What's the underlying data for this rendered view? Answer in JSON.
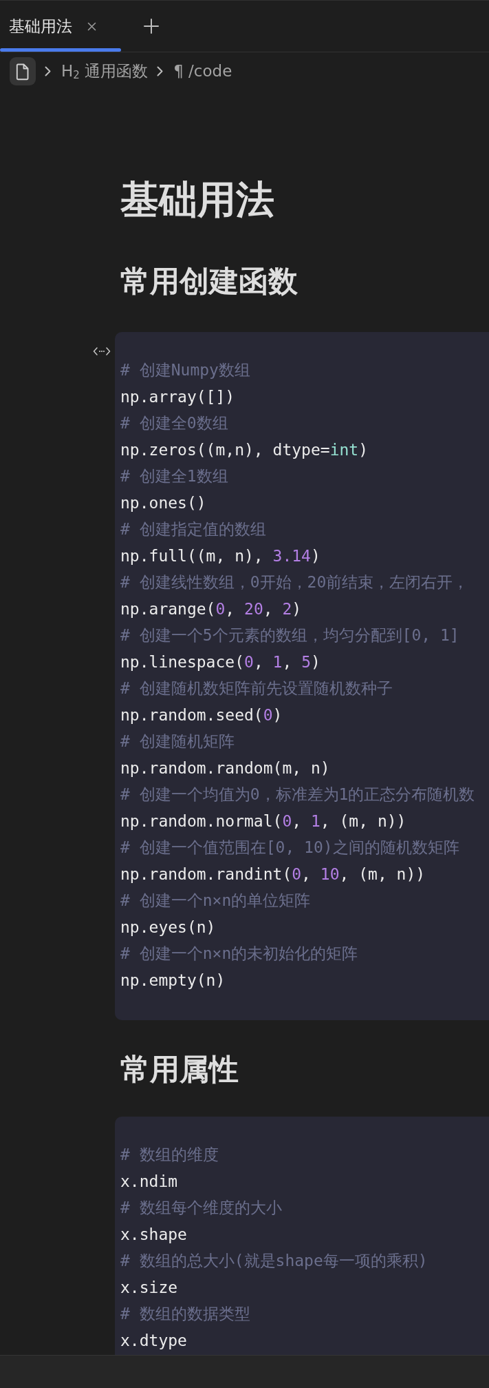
{
  "tabs": [
    {
      "label": "基础用法",
      "selected": true
    }
  ],
  "breadcrumb": [
    {
      "kind": "file"
    },
    {
      "kind": "heading",
      "marker": "H$_{2}$",
      "label": "通用函数"
    },
    {
      "kind": "paragraph",
      "marker": "¶",
      "label": "/code"
    }
  ],
  "title": "基础用法",
  "sections": [
    {
      "heading": "常用创建函数",
      "code_block": {
        "hovered": true,
        "lines": [
          [
            {
              "kind": "comment",
              "text": "# 创建Numpy数组"
            }
          ],
          [
            {
              "kind": "plain",
              "text": "np.array([])"
            }
          ],
          [
            {
              "kind": "comment",
              "text": "# 创建全0数组"
            }
          ],
          [
            {
              "kind": "plain",
              "text": "np.zeros((m,n), dtype="
            },
            {
              "kind": "builtin",
              "text": "int"
            },
            {
              "kind": "plain",
              "text": ")"
            }
          ],
          [
            {
              "kind": "comment",
              "text": "# 创建全1数组"
            }
          ],
          [
            {
              "kind": "plain",
              "text": "np.ones()"
            }
          ],
          [
            {
              "kind": "comment",
              "text": "# 创建指定值的数组"
            }
          ],
          [
            {
              "kind": "plain",
              "text": "np.full((m, n), "
            },
            {
              "kind": "number",
              "text": "3.14"
            },
            {
              "kind": "plain",
              "text": ")"
            }
          ],
          [
            {
              "kind": "comment",
              "text": "# 创建线性数组，0开始，20前结束，左闭右开，"
            }
          ],
          [
            {
              "kind": "plain",
              "text": "np.arange("
            },
            {
              "kind": "number",
              "text": "0"
            },
            {
              "kind": "plain",
              "text": ", "
            },
            {
              "kind": "number",
              "text": "20"
            },
            {
              "kind": "plain",
              "text": ", "
            },
            {
              "kind": "number",
              "text": "2"
            },
            {
              "kind": "plain",
              "text": ")"
            }
          ],
          [
            {
              "kind": "comment",
              "text": "# 创建一个5个元素的数组，均匀分配到[0, 1]"
            }
          ],
          [
            {
              "kind": "plain",
              "text": "np.linespace("
            },
            {
              "kind": "number",
              "text": "0"
            },
            {
              "kind": "plain",
              "text": ", "
            },
            {
              "kind": "number",
              "text": "1"
            },
            {
              "kind": "plain",
              "text": ", "
            },
            {
              "kind": "number",
              "text": "5"
            },
            {
              "kind": "plain",
              "text": ")"
            }
          ],
          [
            {
              "kind": "comment",
              "text": "# 创建随机数矩阵前先设置随机数种子"
            }
          ],
          [
            {
              "kind": "plain",
              "text": "np.random.seed("
            },
            {
              "kind": "number",
              "text": "0"
            },
            {
              "kind": "plain",
              "text": ")"
            }
          ],
          [
            {
              "kind": "comment",
              "text": "# 创建随机矩阵"
            }
          ],
          [
            {
              "kind": "plain",
              "text": "np.random.random(m, n)"
            }
          ],
          [
            {
              "kind": "comment",
              "text": "# 创建一个均值为0，标准差为1的正态分布随机数"
            }
          ],
          [
            {
              "kind": "plain",
              "text": "np.random.normal("
            },
            {
              "kind": "number",
              "text": "0"
            },
            {
              "kind": "plain",
              "text": ", "
            },
            {
              "kind": "number",
              "text": "1"
            },
            {
              "kind": "plain",
              "text": ", (m, n))"
            }
          ],
          [
            {
              "kind": "comment",
              "text": "# 创建一个值范围在[0, 10)之间的随机数矩阵"
            }
          ],
          [
            {
              "kind": "plain",
              "text": "np.random.randint("
            },
            {
              "kind": "number",
              "text": "0"
            },
            {
              "kind": "plain",
              "text": ", "
            },
            {
              "kind": "number",
              "text": "10"
            },
            {
              "kind": "plain",
              "text": ", (m, n))"
            }
          ],
          [
            {
              "kind": "comment",
              "text": "# 创建一个n×n的单位矩阵"
            }
          ],
          [
            {
              "kind": "plain",
              "text": "np.eyes(n)"
            }
          ],
          [
            {
              "kind": "comment",
              "text": "# 创建一个n×n的未初始化的矩阵"
            }
          ],
          [
            {
              "kind": "plain",
              "text": "np.empty(n)"
            }
          ]
        ]
      }
    },
    {
      "heading": "常用属性",
      "code_block": {
        "hovered": false,
        "lines": [
          [
            {
              "kind": "comment",
              "text": "# 数组的维度"
            }
          ],
          [
            {
              "kind": "plain",
              "text": "x.ndim"
            }
          ],
          [
            {
              "kind": "comment",
              "text": "# 数组每个维度的大小"
            }
          ],
          [
            {
              "kind": "plain",
              "text": "x.shape"
            }
          ],
          [
            {
              "kind": "comment",
              "text": "# 数组的总大小(就是shape每一项的乘积)"
            }
          ],
          [
            {
              "kind": "plain",
              "text": "x.size"
            }
          ],
          [
            {
              "kind": "comment",
              "text": "# 数组的数据类型"
            }
          ],
          [
            {
              "kind": "plain",
              "text": "x.dtype"
            }
          ]
        ]
      }
    }
  ]
}
